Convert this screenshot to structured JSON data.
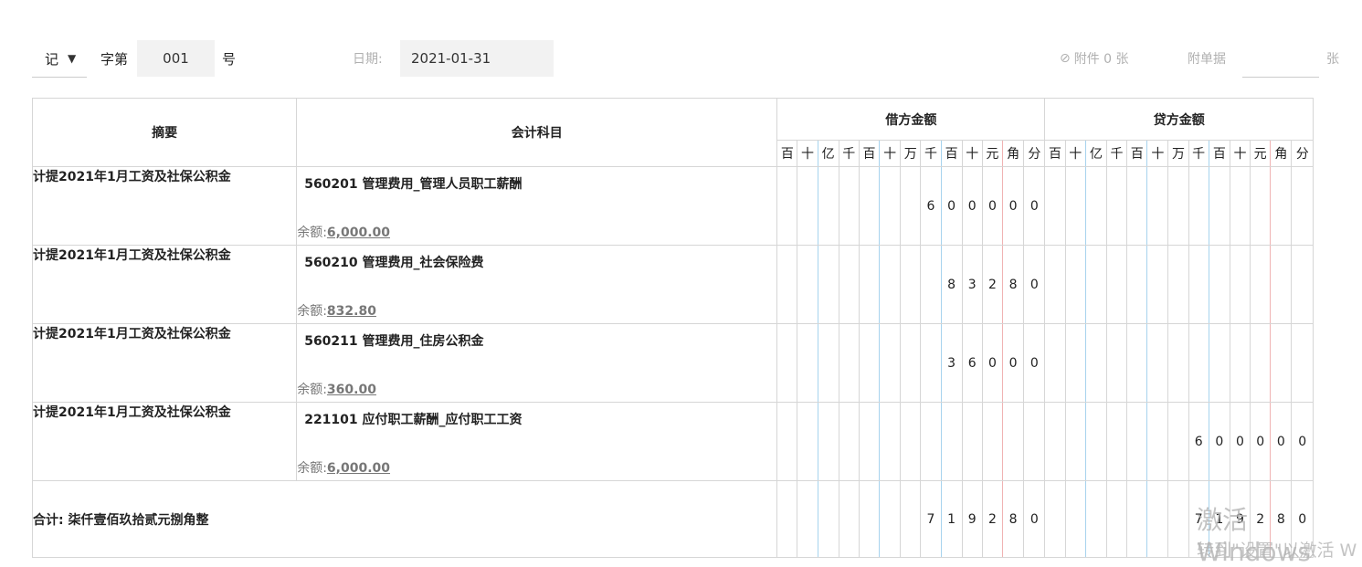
{
  "header": {
    "voucher_type": "记",
    "char_label": "字第",
    "number": "001",
    "hao": "号",
    "date_label": "日期:",
    "date_value": "2021-01-31",
    "attachment_label": "附件 0 张",
    "doc_label": "附单据",
    "doc_unit": "张"
  },
  "table": {
    "col_summary": "摘要",
    "col_account": "会计科目",
    "col_debit": "借方金额",
    "col_credit": "贷方金额",
    "digit_headers": [
      "百",
      "十",
      "亿",
      "千",
      "百",
      "十",
      "万",
      "千",
      "百",
      "十",
      "元",
      "角",
      "分"
    ],
    "balance_label": "余额:",
    "rows": [
      {
        "summary": "计提2021年1月工资及社保公积金",
        "account": "560201 管理费用_管理人员职工薪酬",
        "balance": "6,000.00",
        "debit": "600000",
        "credit": ""
      },
      {
        "summary": "计提2021年1月工资及社保公积金",
        "account": "560210 管理费用_社会保险费",
        "balance": "832.80",
        "debit": "83280",
        "credit": ""
      },
      {
        "summary": "计提2021年1月工资及社保公积金",
        "account": "560211 管理费用_住房公积金",
        "balance": "360.00",
        "debit": "36000",
        "credit": ""
      },
      {
        "summary": "计提2021年1月工资及社保公积金",
        "account": "221101 应付职工薪酬_应付职工工资",
        "balance": "6,000.00",
        "debit": "",
        "credit": "600000"
      }
    ],
    "total": {
      "label": "合计:  柒仟壹佰玖拾贰元捌角整",
      "debit": "719280",
      "credit": "719280"
    }
  },
  "watermark": {
    "line1": "激活 Windows",
    "line2": "转到\"设置\"以激活 W"
  }
}
